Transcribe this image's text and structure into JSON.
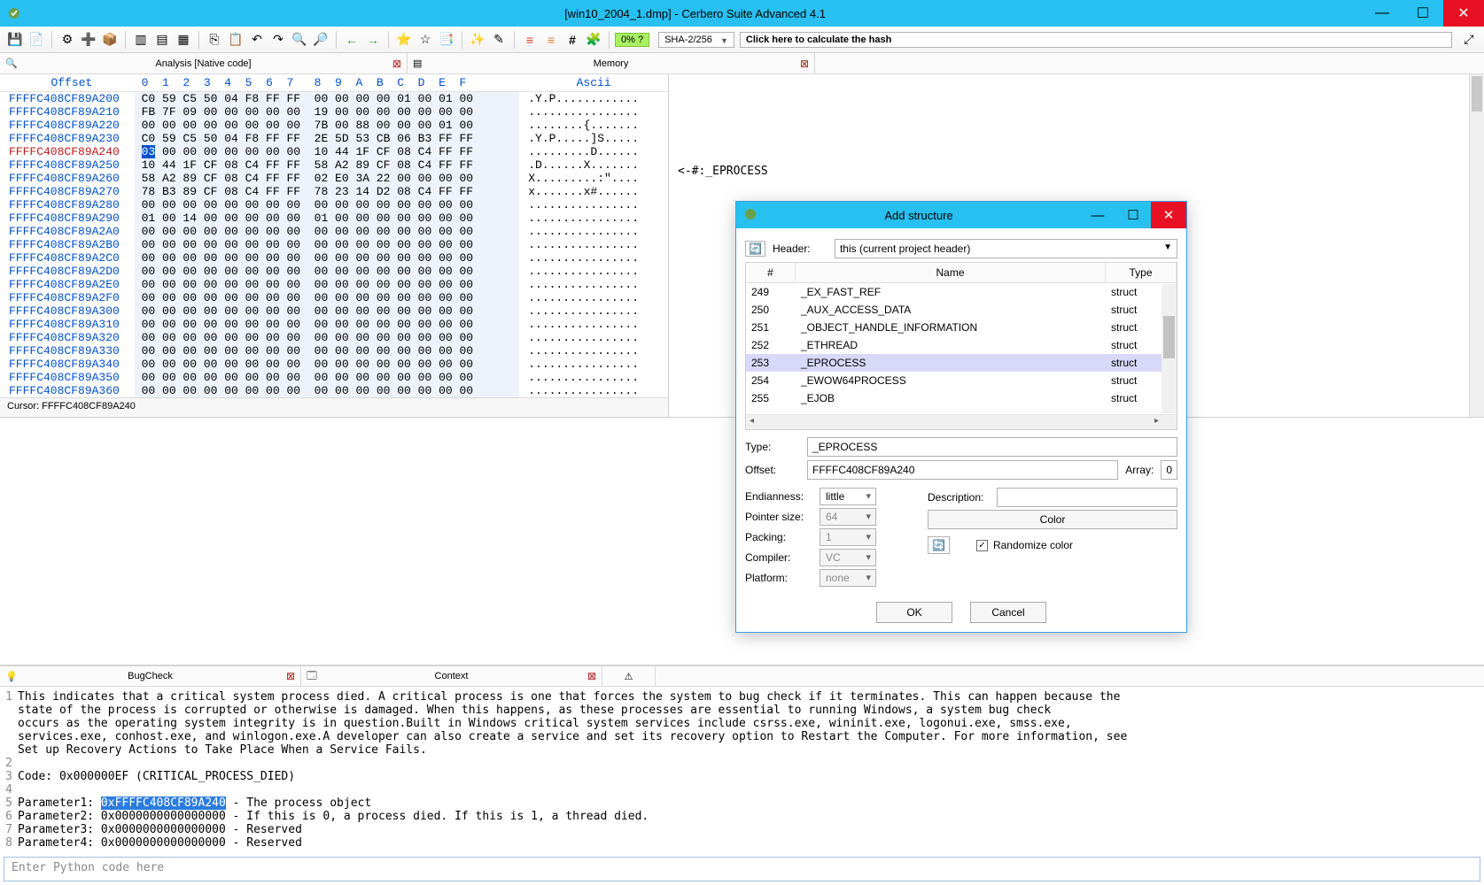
{
  "app": {
    "title": "[win10_2004_1.dmp] - Cerbero Suite Advanced 4.1"
  },
  "toolbar": {
    "pct": "0% ?",
    "hash_algo": "SHA-2/256",
    "hash_field": "Click here to calculate the hash"
  },
  "tabs": {
    "analysis": "Analysis [Native code]",
    "memory": "Memory"
  },
  "hex": {
    "header_offset": "Offset",
    "header_hex": " 0  1  2  3  4  5  6  7   8  9  A  B  C  D  E  F ",
    "header_ascii": "Ascii",
    "rows": [
      {
        "off": "FFFFC408CF89A200",
        "hex": " C0 59 C5 50 04 F8 FF FF  00 00 00 00 01 00 01 00 ",
        "asc": ".Y.P............"
      },
      {
        "off": "FFFFC408CF89A210",
        "hex": " FB 7F 09 00 00 00 00 00  19 00 00 00 00 00 00 00 ",
        "asc": "................"
      },
      {
        "off": "FFFFC408CF89A220",
        "hex": " 00 00 00 00 00 00 00 00  7B 00 88 00 00 00 01 00 ",
        "asc": "........{......."
      },
      {
        "off": "FFFFC408CF89A230",
        "hex": " C0 59 C5 50 04 F8 FF FF  2E 5D 53 CB 06 B3 FF FF ",
        "asc": ".Y.P.....]S....."
      },
      {
        "off": "FFFFC408CF89A240",
        "hex": " 03 00 00 00 00 00 00 00  10 44 1F CF 08 C4 FF FF ",
        "asc": ".........D......",
        "red": true,
        "selFirst": true
      },
      {
        "off": "FFFFC408CF89A250",
        "hex": " 10 44 1F CF 08 C4 FF FF  58 A2 89 CF 08 C4 FF FF ",
        "asc": ".D......X......."
      },
      {
        "off": "FFFFC408CF89A260",
        "hex": " 58 A2 89 CF 08 C4 FF FF  02 E0 3A 22 00 00 00 00 ",
        "asc": "X.........:\"...."
      },
      {
        "off": "FFFFC408CF89A270",
        "hex": " 78 B3 89 CF 08 C4 FF FF  78 23 14 D2 08 C4 FF FF ",
        "asc": "x.......x#......"
      },
      {
        "off": "FFFFC408CF89A280",
        "hex": " 00 00 00 00 00 00 00 00  00 00 00 00 00 00 00 00 ",
        "asc": "................"
      },
      {
        "off": "FFFFC408CF89A290",
        "hex": " 01 00 14 00 00 00 00 00  01 00 00 00 00 00 00 00 ",
        "asc": "................"
      },
      {
        "off": "FFFFC408CF89A2A0",
        "hex": " 00 00 00 00 00 00 00 00  00 00 00 00 00 00 00 00 ",
        "asc": "................"
      },
      {
        "off": "FFFFC408CF89A2B0",
        "hex": " 00 00 00 00 00 00 00 00  00 00 00 00 00 00 00 00 ",
        "asc": "................"
      },
      {
        "off": "FFFFC408CF89A2C0",
        "hex": " 00 00 00 00 00 00 00 00  00 00 00 00 00 00 00 00 ",
        "asc": "................"
      },
      {
        "off": "FFFFC408CF89A2D0",
        "hex": " 00 00 00 00 00 00 00 00  00 00 00 00 00 00 00 00 ",
        "asc": "................"
      },
      {
        "off": "FFFFC408CF89A2E0",
        "hex": " 00 00 00 00 00 00 00 00  00 00 00 00 00 00 00 00 ",
        "asc": "................"
      },
      {
        "off": "FFFFC408CF89A2F0",
        "hex": " 00 00 00 00 00 00 00 00  00 00 00 00 00 00 00 00 ",
        "asc": "................"
      },
      {
        "off": "FFFFC408CF89A300",
        "hex": " 00 00 00 00 00 00 00 00  00 00 00 00 00 00 00 00 ",
        "asc": "................"
      },
      {
        "off": "FFFFC408CF89A310",
        "hex": " 00 00 00 00 00 00 00 00  00 00 00 00 00 00 00 00 ",
        "asc": "................"
      },
      {
        "off": "FFFFC408CF89A320",
        "hex": " 00 00 00 00 00 00 00 00  00 00 00 00 00 00 00 00 ",
        "asc": "................"
      },
      {
        "off": "FFFFC408CF89A330",
        "hex": " 00 00 00 00 00 00 00 00  00 00 00 00 00 00 00 00 ",
        "asc": "................"
      },
      {
        "off": "FFFFC408CF89A340",
        "hex": " 00 00 00 00 00 00 00 00  00 00 00 00 00 00 00 00 ",
        "asc": "................"
      },
      {
        "off": "FFFFC408CF89A350",
        "hex": " 00 00 00 00 00 00 00 00  00 00 00 00 00 00 00 00 ",
        "asc": "................"
      },
      {
        "off": "FFFFC408CF89A360",
        "hex": " 00 00 00 00 00 00 00 00  00 00 00 00 00 00 00 00 ",
        "asc": "................"
      }
    ],
    "annotation": "<-#:_EPROCESS"
  },
  "cursor_bar": "Cursor: FFFFC408CF89A240",
  "lower_tabs": {
    "bug": "BugCheck",
    "ctx": "Context"
  },
  "bug": {
    "lines": [
      {
        "n": "1",
        "t": "This indicates that a critical system process died. A critical process is one that forces the system to bug check if it terminates. This can happen because the"
      },
      {
        "n": "",
        "t": "state of the process is corrupted or otherwise is damaged. When this happens, as these processes are essential to running Windows, a system bug check"
      },
      {
        "n": "",
        "t": "occurs as the operating system integrity is in question.Built in Windows critical system services include csrss.exe, wininit.exe, logonui.exe, smss.exe,"
      },
      {
        "n": "",
        "t": "services.exe, conhost.exe, and winlogon.exe.A developer can also create a service and set its recovery option to Restart the Computer. For more information, see"
      },
      {
        "n": "",
        "t": "Set up Recovery Actions to Take Place When a Service Fails."
      },
      {
        "n": "2",
        "t": ""
      },
      {
        "n": "3",
        "t": "Code: 0x000000EF (CRITICAL_PROCESS_DIED)"
      },
      {
        "n": "4",
        "t": ""
      },
      {
        "n": "5",
        "t": "Parameter1: ",
        "hl": "0xFFFFC408CF89A240",
        "after": " - The process object"
      },
      {
        "n": "6",
        "t": "Parameter2: 0x0000000000000000 - If this is 0, a process died. If this is 1, a thread died."
      },
      {
        "n": "7",
        "t": "Parameter3: 0x0000000000000000 - Reserved"
      },
      {
        "n": "8",
        "t": "Parameter4: 0x0000000000000000 - Reserved"
      }
    ]
  },
  "py_placeholder": "Enter Python code here",
  "dialog": {
    "title": "Add structure",
    "header_label": "Header:",
    "header_value": "this (current project header)",
    "cols": {
      "idx": "#",
      "name": "Name",
      "type": "Type"
    },
    "rows": [
      {
        "i": "249",
        "n": "_EX_FAST_REF",
        "t": "struct"
      },
      {
        "i": "250",
        "n": "_AUX_ACCESS_DATA",
        "t": "struct"
      },
      {
        "i": "251",
        "n": "_OBJECT_HANDLE_INFORMATION",
        "t": "struct"
      },
      {
        "i": "252",
        "n": "_ETHREAD",
        "t": "struct"
      },
      {
        "i": "253",
        "n": "_EPROCESS",
        "t": "struct",
        "sel": true
      },
      {
        "i": "254",
        "n": "_EWOW64PROCESS",
        "t": "struct"
      },
      {
        "i": "255",
        "n": "_EJOB",
        "t": "struct"
      }
    ],
    "type_label": "Type:",
    "type_value": "_EPROCESS",
    "offset_label": "Offset:",
    "offset_value": "FFFFC408CF89A240",
    "array_label": "Array:",
    "array_value": "0",
    "endian_label": "Endianness:",
    "endian_value": "little",
    "ptr_label": "Pointer size:",
    "ptr_value": "64",
    "pack_label": "Packing:",
    "pack_value": "1",
    "comp_label": "Compiler:",
    "comp_value": "VC",
    "plat_label": "Platform:",
    "plat_value": "none",
    "desc_label": "Description:",
    "color_btn": "Color",
    "rand_label": "Randomize color",
    "ok": "OK",
    "cancel": "Cancel"
  }
}
